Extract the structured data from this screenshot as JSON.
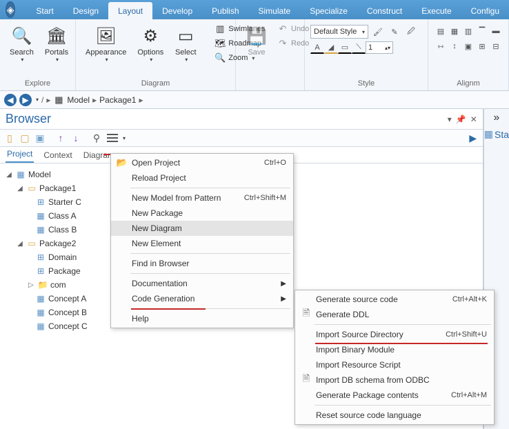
{
  "tabs": [
    "Start",
    "Design",
    "Layout",
    "Develop",
    "Publish",
    "Simulate",
    "Specialize",
    "Construct",
    "Execute",
    "Configu"
  ],
  "active_tab": 2,
  "ribbon": {
    "explore": {
      "label": "Explore",
      "search": "Search",
      "portals": "Portals"
    },
    "appearance": "Appearance",
    "options": "Options",
    "select": "Select",
    "diagram": {
      "label": "Diagram",
      "swimlanes": "Swimlanes",
      "roadmap": "Roadmap",
      "zoom": "Zoom"
    },
    "save": "Save",
    "undo": "Undo",
    "redo": "Redo",
    "style": {
      "label": "Style",
      "default": "Default Style",
      "num": "1"
    },
    "align": "Alignm"
  },
  "breadcrumb": {
    "root": "Model",
    "pkg": "Package1"
  },
  "browser": {
    "title": "Browser",
    "tabs": [
      "Project",
      "Context",
      "Diagram"
    ],
    "active": 0
  },
  "tree": {
    "model": "Model",
    "p1": "Package1",
    "starter": "Starter C",
    "classA": "Class A",
    "classB": "Class B",
    "p2": "Package2",
    "domain": "Domain",
    "package": "Package",
    "com": "com",
    "conceptA": "Concept A",
    "conceptB": "Concept B",
    "conceptC": "Concept C"
  },
  "menu1": {
    "open": "Open Project",
    "open_sc": "Ctrl+O",
    "reload": "Reload Project",
    "newmodel": "New Model from Pattern",
    "newmodel_sc": "Ctrl+Shift+M",
    "newpkg": "New Package",
    "newdiag": "New Diagram",
    "newelem": "New Element",
    "find": "Find in Browser",
    "doc": "Documentation",
    "codegen": "Code Generation",
    "help": "Help"
  },
  "menu2": {
    "gen_src": "Generate source code",
    "gen_src_sc": "Ctrl+Alt+K",
    "gen_ddl": "Generate DDL",
    "imp_src": "Import Source Directory",
    "imp_src_sc": "Ctrl+Shift+U",
    "imp_bin": "Import Binary Module",
    "imp_res": "Import Resource Script",
    "imp_db": "Import DB schema from ODBC",
    "gen_pkg": "Generate Package contents",
    "gen_pkg_sc": "Ctrl+Alt+M",
    "reset": "Reset source code language"
  },
  "right_panel": {
    "start_label": "Sta",
    "expand": "»"
  }
}
